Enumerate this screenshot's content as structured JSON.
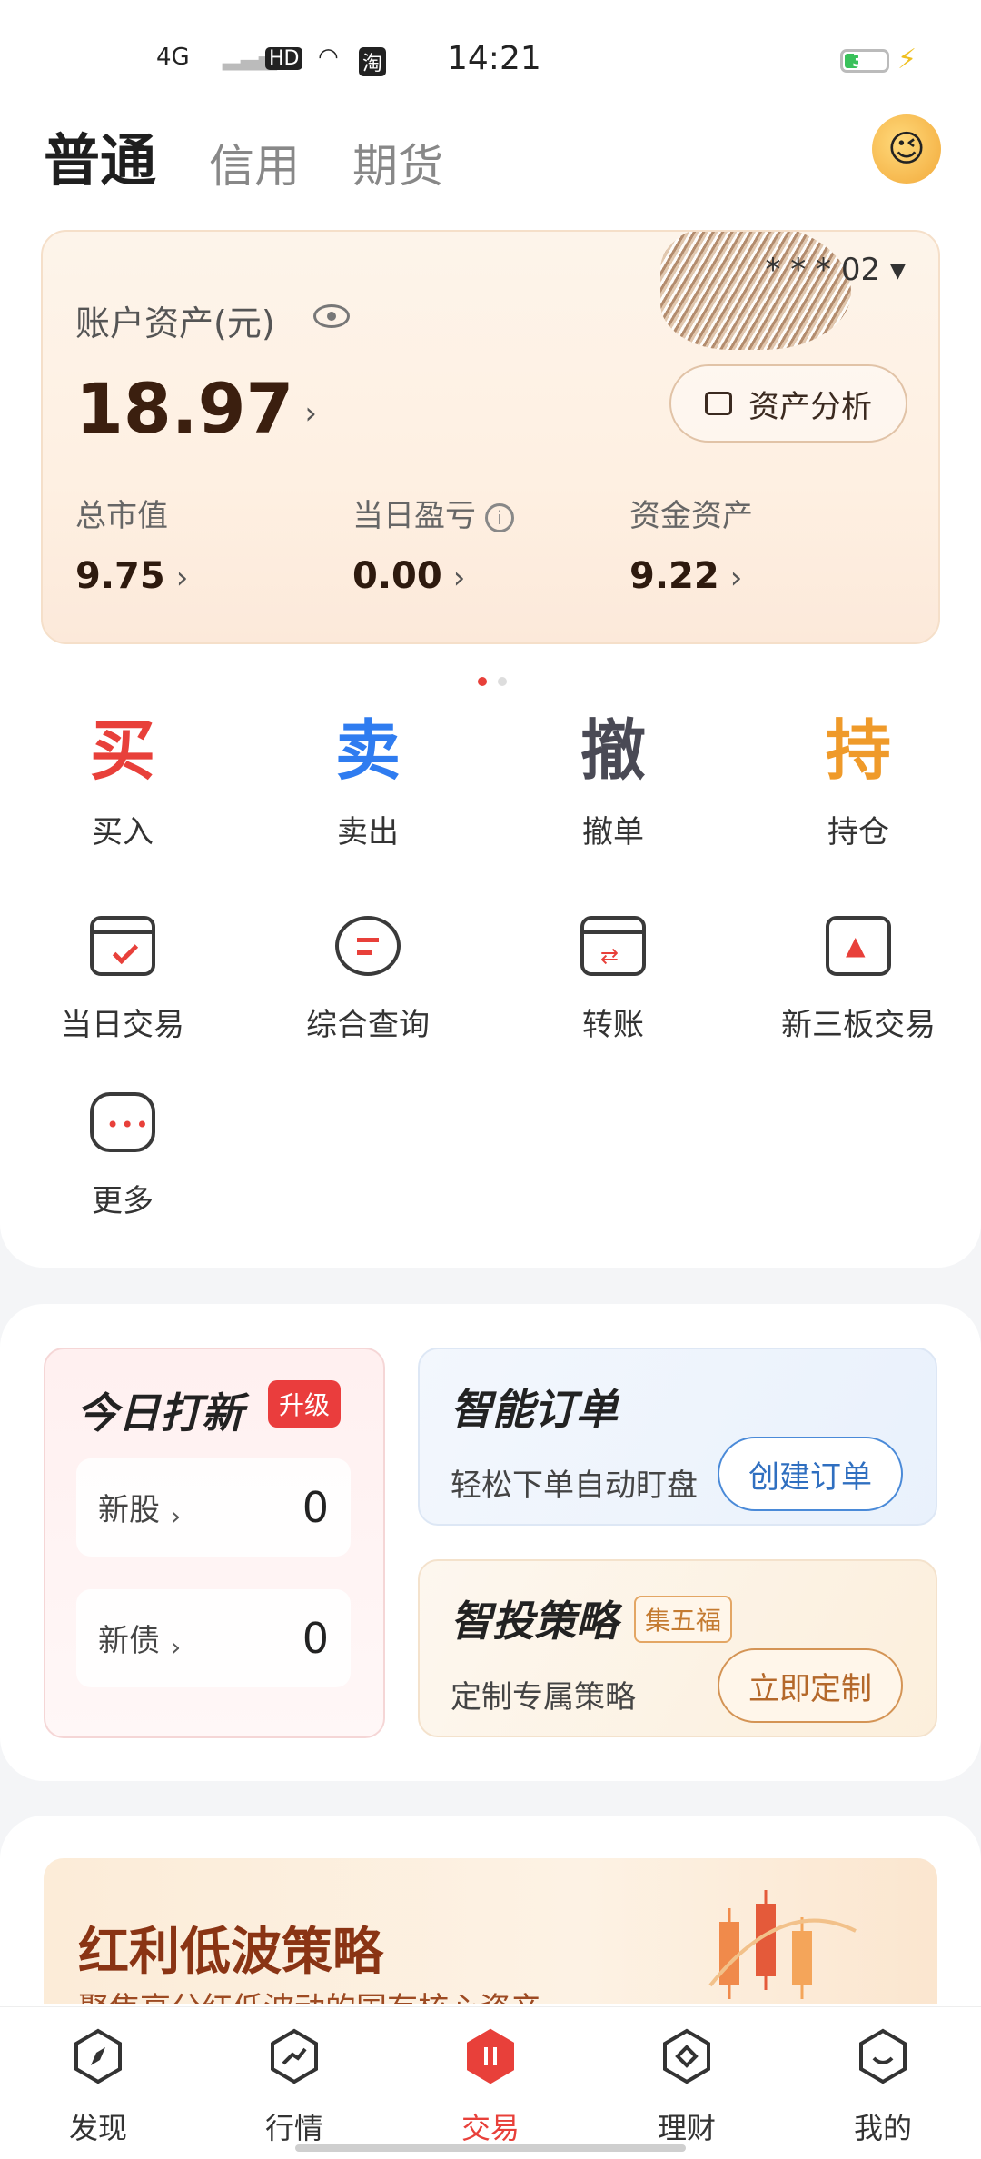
{
  "status_bar": {
    "network": "4G",
    "hd": "HD",
    "app_badge": "淘",
    "time": "14:21",
    "battery": "31"
  },
  "tabs": [
    {
      "label": "普通",
      "active": true
    },
    {
      "label": "信用",
      "active": false
    },
    {
      "label": "期货",
      "active": false
    }
  ],
  "asset_card": {
    "account": "* * * 02 ▾",
    "label": "账户资产(元)",
    "total": "18.97",
    "analysis_button": "资产分析",
    "metrics": [
      {
        "label": "总市值",
        "value": "9.75"
      },
      {
        "label": "当日盈亏",
        "value": "0.00"
      },
      {
        "label": "资金资产",
        "value": "9.22"
      }
    ]
  },
  "actions": [
    {
      "char": "买",
      "label": "买入",
      "color": "#e8403a"
    },
    {
      "char": "卖",
      "label": "卖出",
      "color": "#2f7cf0"
    },
    {
      "char": "撤",
      "label": "撤单",
      "color": "#4a4a55"
    },
    {
      "char": "持",
      "label": "持仓",
      "color": "#ef9a2a"
    }
  ],
  "tools": [
    {
      "label": "当日交易",
      "icon": "calendar-check-icon"
    },
    {
      "label": "综合查询",
      "icon": "search-query-icon"
    },
    {
      "label": "转账",
      "icon": "transfer-icon"
    },
    {
      "label": "新三板交易",
      "icon": "monitor-chart-icon"
    },
    {
      "label": "更多",
      "icon": "more-icon"
    }
  ],
  "ipo": {
    "title": "今日打新",
    "badge": "升级",
    "rows": [
      {
        "name": "新股",
        "count": "0"
      },
      {
        "name": "新债",
        "count": "0"
      }
    ]
  },
  "smart_order": {
    "title": "智能订单",
    "subtitle": "轻松下单自动盯盘",
    "button": "创建订单"
  },
  "strategy": {
    "title": "智投策略",
    "badge": "集五福",
    "subtitle": "定制专属策略",
    "button": "立即定制"
  },
  "banner": {
    "title": "红利低波策略",
    "subtitle": "聚焦高分红低波动的国有核心资产"
  },
  "bottom_nav": [
    {
      "label": "发现",
      "icon": "compass-icon",
      "active": false
    },
    {
      "label": "行情",
      "icon": "trend-icon",
      "active": false
    },
    {
      "label": "交易",
      "icon": "trade-icon",
      "active": true
    },
    {
      "label": "理财",
      "icon": "diamond-icon",
      "active": false
    },
    {
      "label": "我的",
      "icon": "profile-icon",
      "active": false
    }
  ],
  "colors": {
    "accent_red": "#e8403a",
    "accent_blue": "#2f7cf0",
    "accent_orange": "#ef9a2a"
  }
}
